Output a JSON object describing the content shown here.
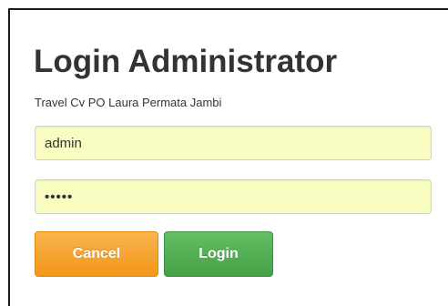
{
  "form": {
    "title": "Login Administrator",
    "subtitle": "Travel Cv PO Laura Permata Jambi",
    "username_value": "admin",
    "password_value": "•••••",
    "field_background": "#fafdc1"
  },
  "buttons": {
    "cancel_label": "Cancel",
    "cancel_color": "#f0961a",
    "login_label": "Login",
    "login_color": "#46a046"
  }
}
